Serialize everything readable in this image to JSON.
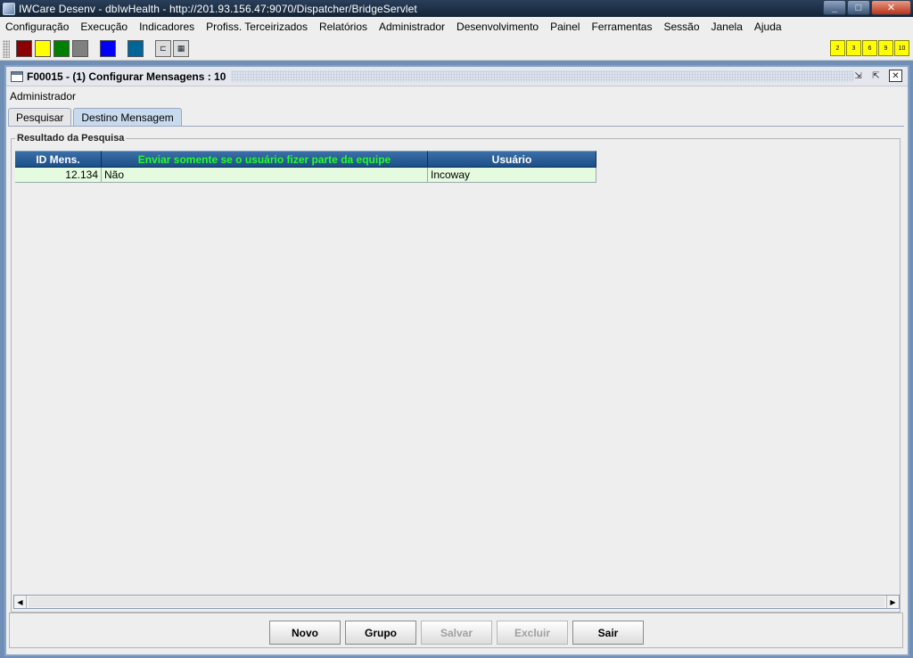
{
  "window": {
    "title": "IWCare Desenv - dbIwHealth - http://201.93.156.47:9070/Dispatcher/BridgeServlet",
    "controls": [
      "_",
      "□",
      "✕"
    ]
  },
  "menu": [
    "Configuração",
    "Execução",
    "Indicadores",
    "Profiss. Terceirizados",
    "Relatórios",
    "Administrador",
    "Desenvolvimento",
    "Painel",
    "Ferramentas",
    "Sessão",
    "Janela",
    "Ajuda"
  ],
  "toolbar": {
    "swatches": [
      "#8b0000",
      "#ffff00",
      "#008000",
      "#808080",
      "#0000ff",
      "#006699"
    ],
    "window_numbers": [
      "2",
      "3",
      "6",
      "9",
      "10"
    ]
  },
  "frame": {
    "title": "F00015 - (1) Configurar Mensagens : 10",
    "header": "Administrador",
    "tabs": [
      "Pesquisar",
      "Destino Mensagem"
    ],
    "active_tab": "Destino Mensagem",
    "group_label": "Resultado da Pesquisa",
    "table": {
      "columns": [
        "ID Mens.",
        "Enviar somente se o usuário fizer parte da equipe",
        "Usuário"
      ],
      "rows": [
        [
          "12.134",
          "Não",
          "Incoway"
        ]
      ]
    },
    "buttons": [
      "Novo",
      "Grupo",
      "Salvar",
      "Excluir",
      "Sair"
    ],
    "disabled_buttons": [
      "Salvar",
      "Excluir"
    ]
  }
}
